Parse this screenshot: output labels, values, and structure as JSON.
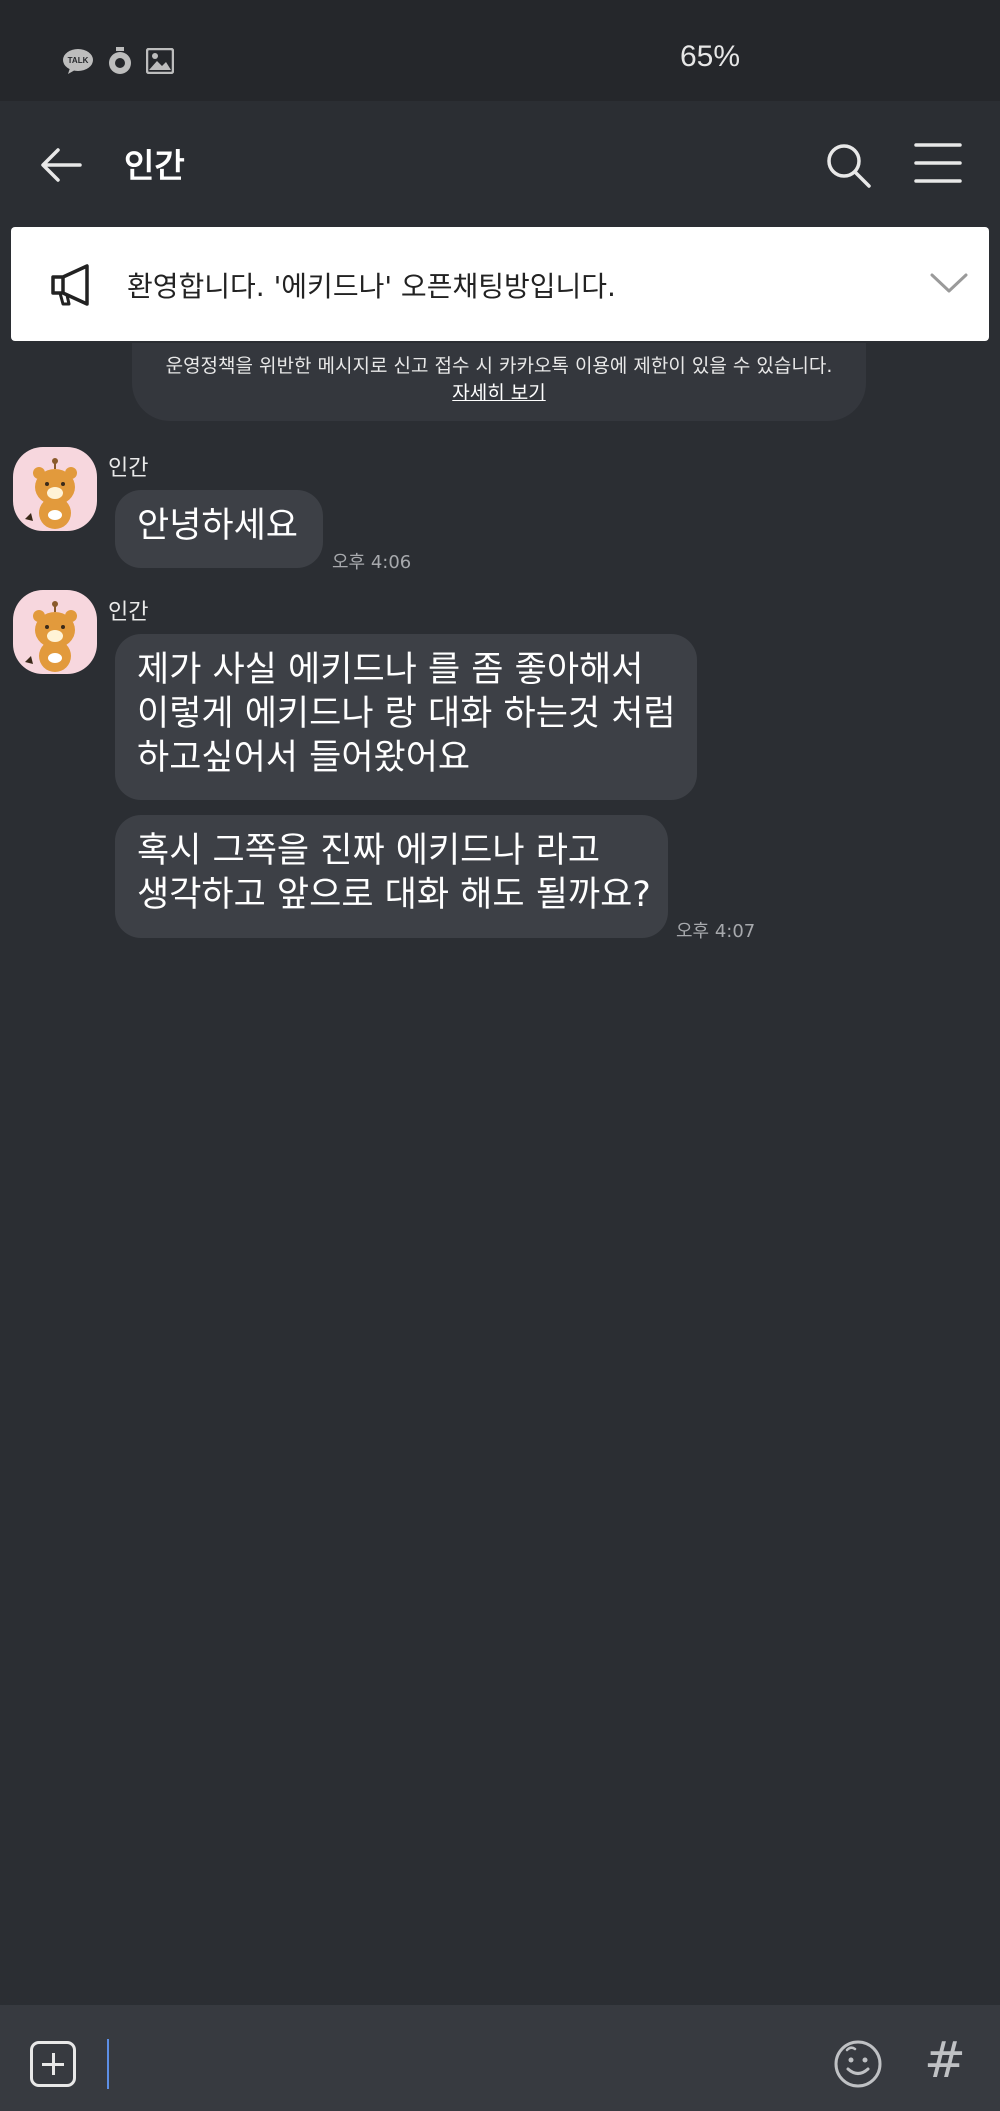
{
  "status_bar": {
    "icons": [
      "talk-icon",
      "timer-icon",
      "image-icon"
    ],
    "battery": "65%"
  },
  "header": {
    "title": "인간"
  },
  "notice": {
    "text": "환영합니다. '에키드나' 오픈채팅방입니다."
  },
  "warning": {
    "text": "운영정책을 위반한 메시지로 신고 접수 시 카카오톡 이용에 제한이 있을 수 있습니다.",
    "link": "자세히 보기"
  },
  "messages": [
    {
      "sender": "인간",
      "bubbles": [
        "안녕하세요"
      ],
      "time": "오후 4:06"
    },
    {
      "sender": "인간",
      "bubbles": [
        "제가 사실 에키드나 를 좀 좋아해서\n이렇게 에키드나 랑 대화 하는것 처럼\n하고싶어서 들어왔어요",
        "혹시 그쪽을 진짜 에키드나 라고\n생각하고 앞으로 대화 해도 될까요?"
      ],
      "time": "오후 4:07"
    }
  ],
  "colors": {
    "background": "#2b2e33",
    "bubble": "#3d4046",
    "notice_bg": "#ffffff",
    "avatar_bg": "#f7d7de",
    "caret": "#5d8fe6"
  }
}
